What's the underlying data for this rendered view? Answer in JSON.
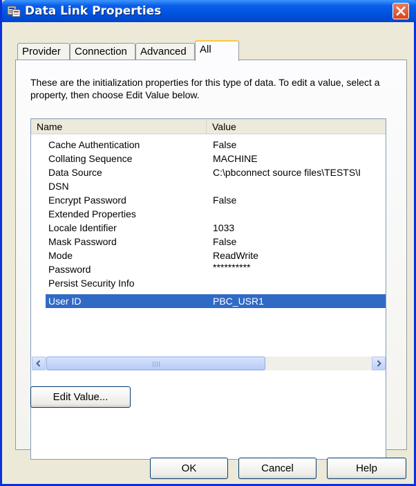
{
  "window": {
    "title": "Data Link Properties",
    "icon": "data-link-icon",
    "close_icon": "close-icon"
  },
  "tabs": [
    {
      "label": "Provider",
      "active": false
    },
    {
      "label": "Connection",
      "active": false
    },
    {
      "label": "Advanced",
      "active": false
    },
    {
      "label": "All",
      "active": true
    }
  ],
  "description": "These are the initialization properties for this type of data. To edit a value, select a property, then choose Edit Value below.",
  "properties_list": {
    "columns": [
      "Name",
      "Value"
    ],
    "rows": [
      {
        "name": "Cache Authentication",
        "value": "False"
      },
      {
        "name": "Collating Sequence",
        "value": "MACHINE"
      },
      {
        "name": "Data Source",
        "value": "C:\\pbconnect source files\\TESTS\\I"
      },
      {
        "name": "DSN",
        "value": ""
      },
      {
        "name": "Encrypt Password",
        "value": "False"
      },
      {
        "name": "Extended Properties",
        "value": ""
      },
      {
        "name": "Locale Identifier",
        "value": "1033"
      },
      {
        "name": "Mask Password",
        "value": "False"
      },
      {
        "name": "Mode",
        "value": "ReadWrite"
      },
      {
        "name": "Password",
        "value": "**********"
      },
      {
        "name": "Persist Security Info",
        "value": ""
      },
      {
        "name": "User ID",
        "value": "PBC_USR1"
      }
    ],
    "selected_row": "User ID"
  },
  "buttons": {
    "edit_value": "Edit Value...",
    "ok": "OK",
    "cancel": "Cancel",
    "help": "Help"
  },
  "colors": {
    "titlebar": "#0054E3",
    "selection": "#316AC5",
    "dialog_bg": "#ECE9D8",
    "close_button": "#D9431A"
  }
}
